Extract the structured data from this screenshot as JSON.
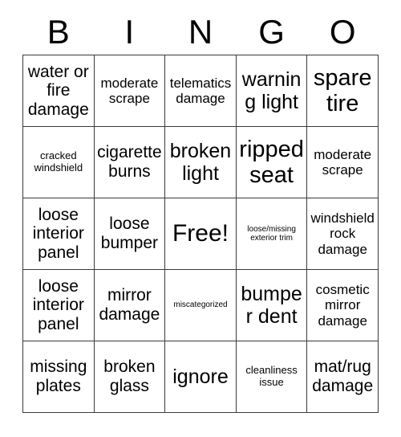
{
  "card": {
    "title_letters": [
      "B",
      "I",
      "N",
      "G",
      "O"
    ],
    "columns": 5,
    "rows": 5,
    "free_space": {
      "row": 3,
      "column": 3,
      "label": "Free!"
    },
    "colors": {
      "background": "#ffffff",
      "text": "#000000",
      "grid_border": "#3a3a3a"
    },
    "cells": [
      [
        {
          "text": "water or fire damage",
          "size": "md"
        },
        {
          "text": "moderate scrape",
          "size": "sm"
        },
        {
          "text": "telematics damage",
          "size": "sm"
        },
        {
          "text": "warning light",
          "size": "lg"
        },
        {
          "text": "spare tire",
          "size": "xl"
        }
      ],
      [
        {
          "text": "cracked windshield",
          "size": "xs"
        },
        {
          "text": "cigarette burns",
          "size": "md"
        },
        {
          "text": "broken light",
          "size": "lg"
        },
        {
          "text": "ripped seat",
          "size": "xl"
        },
        {
          "text": "moderate scrape",
          "size": "sm"
        }
      ],
      [
        {
          "text": "loose interior panel",
          "size": "md"
        },
        {
          "text": "loose bumper",
          "size": "md"
        },
        {
          "text": "Free!",
          "size": "free"
        },
        {
          "text": "loose/missing exterior trim",
          "size": "xxs"
        },
        {
          "text": "windshield rock damage",
          "size": "sm"
        }
      ],
      [
        {
          "text": "loose interior panel",
          "size": "md"
        },
        {
          "text": "mirror damage",
          "size": "md"
        },
        {
          "text": "miscategorized",
          "size": "xxs"
        },
        {
          "text": "bumper dent",
          "size": "lg"
        },
        {
          "text": "cosmetic mirror damage",
          "size": "sm"
        }
      ],
      [
        {
          "text": "missing plates",
          "size": "md"
        },
        {
          "text": "broken glass",
          "size": "md"
        },
        {
          "text": "ignore",
          "size": "lg"
        },
        {
          "text": "cleanliness issue",
          "size": "xs"
        },
        {
          "text": "mat/rug damage",
          "size": "md"
        }
      ]
    ]
  }
}
